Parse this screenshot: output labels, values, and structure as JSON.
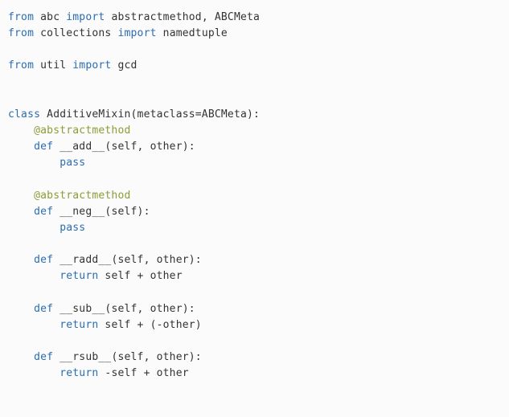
{
  "code": {
    "lines": [
      {
        "tokens": [
          {
            "cls": "kw",
            "t": "from"
          },
          {
            "cls": "plain",
            "t": " abc "
          },
          {
            "cls": "kw",
            "t": "import"
          },
          {
            "cls": "plain",
            "t": " abstractmethod, ABCMeta"
          }
        ]
      },
      {
        "tokens": [
          {
            "cls": "kw",
            "t": "from"
          },
          {
            "cls": "plain",
            "t": " collections "
          },
          {
            "cls": "kw",
            "t": "import"
          },
          {
            "cls": "plain",
            "t": " namedtuple"
          }
        ]
      },
      {
        "tokens": []
      },
      {
        "tokens": [
          {
            "cls": "kw",
            "t": "from"
          },
          {
            "cls": "plain",
            "t": " util "
          },
          {
            "cls": "kw",
            "t": "import"
          },
          {
            "cls": "plain",
            "t": " gcd"
          }
        ]
      },
      {
        "tokens": []
      },
      {
        "tokens": []
      },
      {
        "tokens": [
          {
            "cls": "kw",
            "t": "class"
          },
          {
            "cls": "plain",
            "t": " AdditiveMixin(metaclass=ABCMeta):"
          }
        ]
      },
      {
        "tokens": [
          {
            "cls": "plain",
            "t": "    "
          },
          {
            "cls": "dec",
            "t": "@abstractmethod"
          }
        ]
      },
      {
        "tokens": [
          {
            "cls": "plain",
            "t": "    "
          },
          {
            "cls": "kw",
            "t": "def"
          },
          {
            "cls": "plain",
            "t": " __add__(self, other):"
          }
        ]
      },
      {
        "tokens": [
          {
            "cls": "plain",
            "t": "        "
          },
          {
            "cls": "kw",
            "t": "pass"
          }
        ]
      },
      {
        "tokens": []
      },
      {
        "tokens": [
          {
            "cls": "plain",
            "t": "    "
          },
          {
            "cls": "dec",
            "t": "@abstractmethod"
          }
        ]
      },
      {
        "tokens": [
          {
            "cls": "plain",
            "t": "    "
          },
          {
            "cls": "kw",
            "t": "def"
          },
          {
            "cls": "plain",
            "t": " __neg__(self):"
          }
        ]
      },
      {
        "tokens": [
          {
            "cls": "plain",
            "t": "        "
          },
          {
            "cls": "kw",
            "t": "pass"
          }
        ]
      },
      {
        "tokens": []
      },
      {
        "tokens": [
          {
            "cls": "plain",
            "t": "    "
          },
          {
            "cls": "kw",
            "t": "def"
          },
          {
            "cls": "plain",
            "t": " __radd__(self, other):"
          }
        ]
      },
      {
        "tokens": [
          {
            "cls": "plain",
            "t": "        "
          },
          {
            "cls": "kw",
            "t": "return"
          },
          {
            "cls": "plain",
            "t": " self + other"
          }
        ]
      },
      {
        "tokens": []
      },
      {
        "tokens": [
          {
            "cls": "plain",
            "t": "    "
          },
          {
            "cls": "kw",
            "t": "def"
          },
          {
            "cls": "plain",
            "t": " __sub__(self, other):"
          }
        ]
      },
      {
        "tokens": [
          {
            "cls": "plain",
            "t": "        "
          },
          {
            "cls": "kw",
            "t": "return"
          },
          {
            "cls": "plain",
            "t": " self + (-other)"
          }
        ]
      },
      {
        "tokens": []
      },
      {
        "tokens": [
          {
            "cls": "plain",
            "t": "    "
          },
          {
            "cls": "kw",
            "t": "def"
          },
          {
            "cls": "plain",
            "t": " __rsub__(self, other):"
          }
        ]
      },
      {
        "tokens": [
          {
            "cls": "plain",
            "t": "        "
          },
          {
            "cls": "kw",
            "t": "return"
          },
          {
            "cls": "plain",
            "t": " -self + other"
          }
        ]
      }
    ]
  }
}
